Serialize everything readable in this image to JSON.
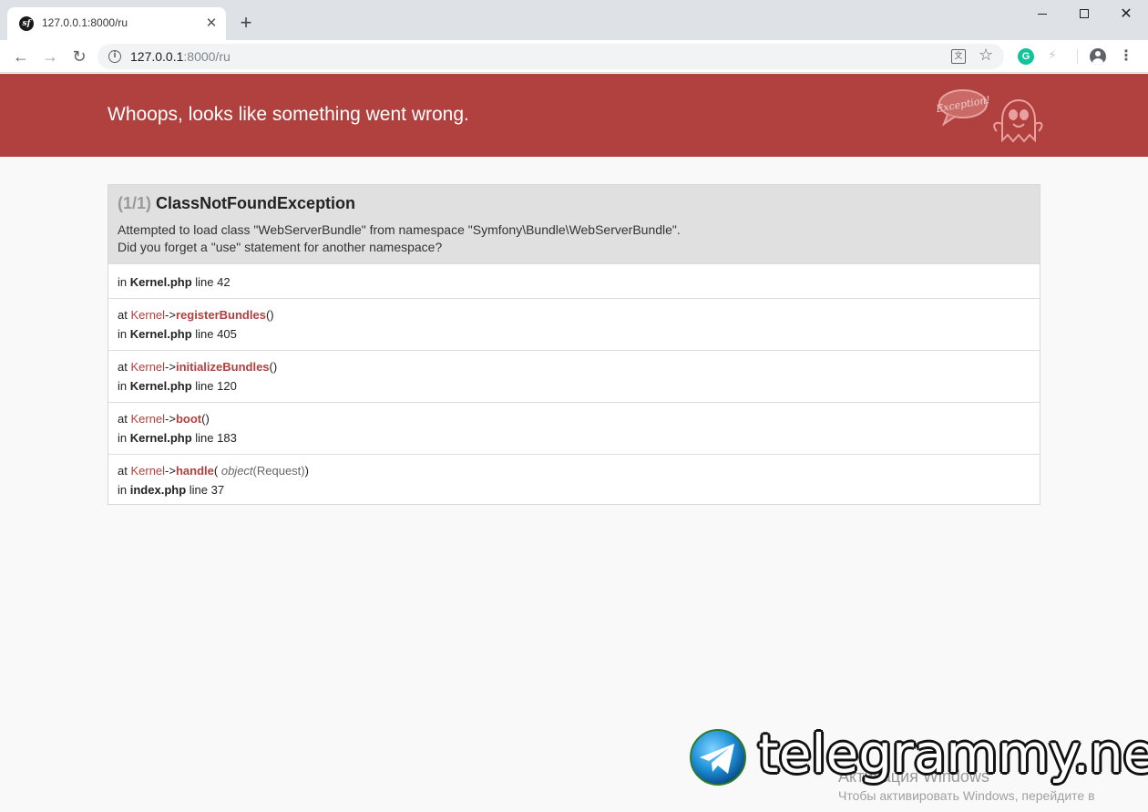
{
  "browser": {
    "tab_title": "127.0.0.1:8000/ru",
    "favicon_text": "sf",
    "tab_close": "✕",
    "new_tab": "+",
    "window_close": "✕",
    "url_host": "127.0.0.1",
    "url_rest": ":8000/ru",
    "info_icon_text": "i",
    "translate_icon_text": "文",
    "star": "☆",
    "extension_letter": "G",
    "bolt": "⚡",
    "menu": "⋮",
    "nav": {
      "back": "←",
      "forward": "→",
      "reload": "↻"
    }
  },
  "page": {
    "header_title": "Whoops, looks like something went wrong.",
    "ghost_bubble_text": "Exception!",
    "exception": {
      "count": "(1/1)",
      "class": "ClassNotFoundException",
      "message_line1": "Attempted to load class \"WebServerBundle\" from namespace \"Symfony\\Bundle\\WebServerBundle\".",
      "message_line2": "Did you forget a \"use\" statement for another namespace?"
    },
    "trace": [
      {
        "in": "in",
        "file": "Kernel.php",
        "line": "line 42"
      },
      {
        "at": "at",
        "cls": "Kernel",
        "arrow": "->",
        "fn": "registerBundles",
        "args_open": "(",
        "args_close": ")",
        "in": "in",
        "file": "Kernel.php",
        "line": "line 405"
      },
      {
        "at": "at",
        "cls": "Kernel",
        "arrow": "->",
        "fn": "initializeBundles",
        "args_open": "(",
        "args_close": ")",
        "in": "in",
        "file": "Kernel.php",
        "line": "line 120"
      },
      {
        "at": "at",
        "cls": "Kernel",
        "arrow": "->",
        "fn": "boot",
        "args_open": "(",
        "args_close": ")",
        "in": "in",
        "file": "Kernel.php",
        "line": "line 183"
      },
      {
        "at": "at",
        "cls": "Kernel",
        "arrow": "->",
        "fn": "handle",
        "args_open": "(",
        "arg_type": "object",
        "arg_val": "(Request)",
        "args_close": ")",
        "in": "in",
        "file": "index.php",
        "line": "line 37"
      }
    ]
  },
  "watermark": {
    "windows_activate": "Активация Windows",
    "windows_activate_sub": "Чтобы активировать Windows, перейдите в",
    "telegram_text": "telegrammy.net"
  },
  "colors": {
    "header": "#b0413e",
    "accent": "#b0413e"
  }
}
